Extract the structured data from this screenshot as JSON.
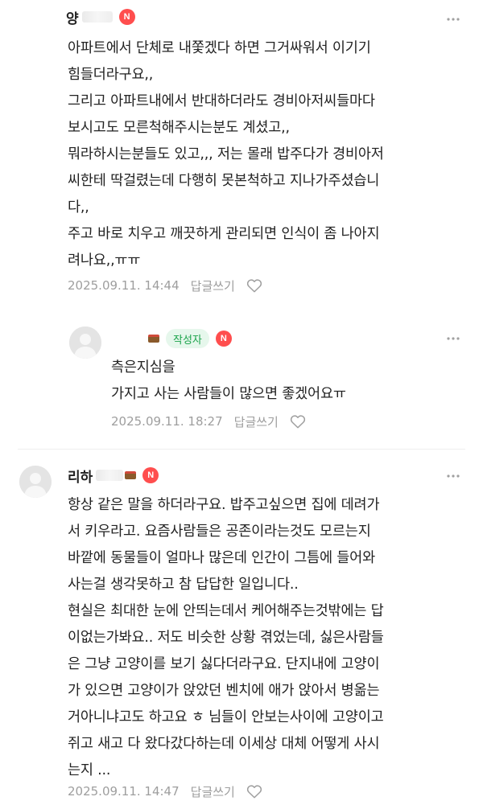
{
  "comments": [
    {
      "author": "양",
      "badge": "N",
      "text": "아파트에서 단체로 내쫓겠다 하면 그거싸워서 이기기\n힘들더라구요,,\n그리고 아파트내에서 반대하더라도 경비아저씨들마다\n보시고도 모른척해주시는분도 계셨고,,\n뭐라하시는분들도 있고,,, 저는 몰래 밥주다가 경비아저\n씨한테 딱걸렸는데 다행히 못본척하고 지나가주셨습니\n다,,\n주고 바로 치우고 깨끗하게 관리되면 인식이 좀 나아지\n려나요,,ㅠㅠ",
      "date": "2025.09.11. 14:44",
      "reply_label": "답글쓰기"
    },
    {
      "author": "",
      "writer_label": "작성자",
      "badge": "N",
      "text": "측은지심을\n가지고 사는 사람들이 많으면 좋겠어요ㅠ",
      "date": "2025.09.11. 18:27",
      "reply_label": "답글쓰기"
    },
    {
      "author": "리하",
      "badge": "N",
      "text": "항상 같은 말을 하더라구요. 밥주고싶으면 집에 데려가\n서 키우라고. 요즘사람들은 공존이라는것도 모르는지\n바깥에 동물들이 얼마나 많은데 인간이 그틈에 들어와\n사는걸 생각못하고 참 답답한 일입니다..\n현실은 최대한 눈에 안띄는데서 케어해주는것밖에는 답\n이없는가봐요.. 저도 비슷한 상황 겪었는데, 싫은사람들\n은 그냥 고양이를 보기 싫다더라구요. 단지내에 고양이\n가 있으면 고양이가 앉았던 벤치에 애가 앉아서 병옮는\n거아니냐고도 하고요 ㅎ 님들이 안보는사이에 고양이고\n쥐고 새고 다 왔다갔다하는데 이세상 대체 어떻게 사시\n는지 ...",
      "date": "2025.09.11. 14:47",
      "reply_label": "답글쓰기"
    }
  ],
  "icons": {
    "more": "more-vertical-icon",
    "like": "heart-outline-icon",
    "avatar": "default-avatar-icon"
  },
  "colors": {
    "badge_red": "#ff4e4e",
    "writer_green": "#1aa34a",
    "meta_gray": "#9e9e9e"
  }
}
